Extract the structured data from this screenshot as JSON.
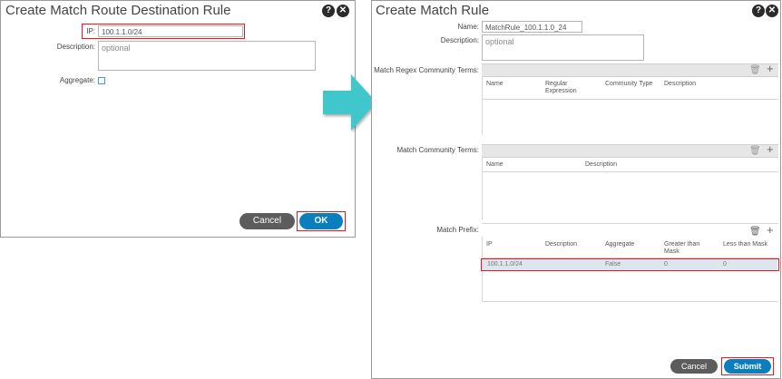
{
  "dialog1": {
    "title": "Create Match Route Destination Rule",
    "ip_label": "IP:",
    "ip_value": "100.1.1.0/24",
    "description_label": "Description:",
    "description_placeholder": "optional",
    "aggregate_label": "Aggregate:",
    "cancel_label": "Cancel",
    "ok_label": "OK"
  },
  "dialog2": {
    "title": "Create Match Rule",
    "name_label": "Name:",
    "name_value": "MatchRule_100.1.1.0_24",
    "description_label": "Description:",
    "description_placeholder": "optional",
    "regex_label": "Match Regex Community Terms:",
    "regex_columns": [
      "Name",
      "Regular Expression",
      "Community Type",
      "Description"
    ],
    "community_label": "Match Community Terms:",
    "community_columns": [
      "Name",
      "Description"
    ],
    "prefix_label": "Match Prefix:",
    "prefix_columns": [
      "IP",
      "Description",
      "Aggregate",
      "Greater than Mask",
      "Less than Mask"
    ],
    "prefix_rows": [
      {
        "ip": "100.1.1.0/24",
        "description": "",
        "aggregate": "False",
        "greater": "0",
        "less": "0"
      }
    ],
    "cancel_label": "Cancel",
    "submit_label": "Submit"
  },
  "icons": {
    "help": "help-icon",
    "close": "close-icon",
    "delete": "trash-icon",
    "add": "plus-icon",
    "arrow": "right-arrow-icon"
  },
  "colors": {
    "accent": "#0b7fbd",
    "highlight": "#e21a22",
    "arrow": "#3fc7cc",
    "cancel": "#5c5c5c"
  }
}
